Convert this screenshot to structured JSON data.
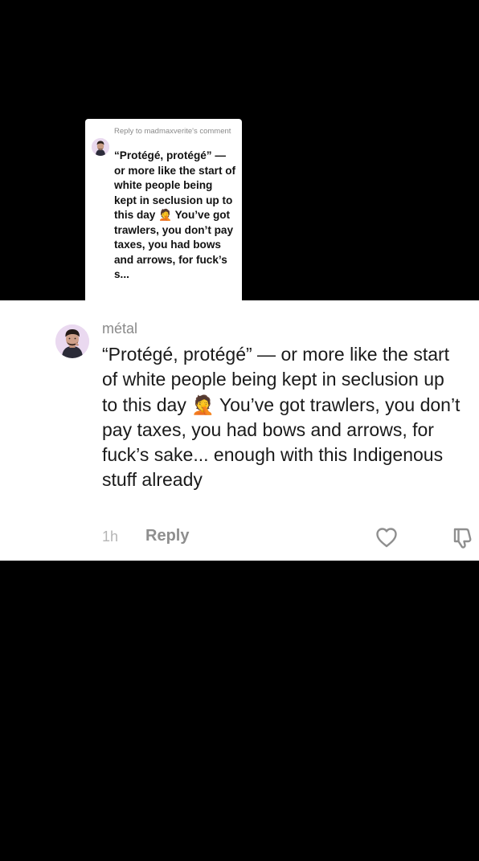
{
  "reply_sticker": {
    "header": "Reply to madmaxverite's comment",
    "text": "“Protégé, protégé” — or more like the start of white people being kept in seclusion up to this day 🤦 You’ve got trawlers, you don’t pay taxes, you had bows and arrows, for fuck’s s..."
  },
  "comment": {
    "username": "métal",
    "text": "“Protégé, protégé” — or more like the start of white people being kept in seclusion up to this day 🤦 You’ve got trawlers, you don’t pay taxes, you had bows and arrows, for fuck’s sake... enough with this Indigenous stuff already",
    "time": "1h",
    "reply_label": "Reply"
  },
  "icons": {
    "like": "heart-icon",
    "dislike": "thumbs-down-icon"
  }
}
